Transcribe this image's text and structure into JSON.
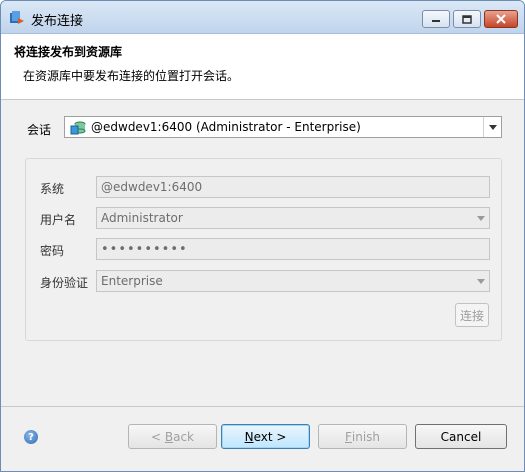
{
  "window": {
    "title": "发布连接"
  },
  "header": {
    "title": "将连接发布到资源库",
    "description": "在资源库中要发布连接的位置打开会话。"
  },
  "session": {
    "label": "会话",
    "value": "@edwdev1:6400 (Administrator - Enterprise)"
  },
  "fields": {
    "system": {
      "label": "系统",
      "value": "@edwdev1:6400"
    },
    "username": {
      "label": "用户名",
      "value": "Administrator"
    },
    "password": {
      "label": "密码",
      "value": "••••••••••"
    },
    "auth": {
      "label": "身份验证",
      "value": "Enterprise"
    }
  },
  "connect_label": "连接",
  "buttons": {
    "back_prefix": "< ",
    "back_key": "B",
    "back_rest": "ack",
    "next_key": "N",
    "next_rest": "ext >",
    "finish_key": "F",
    "finish_rest": "inish",
    "cancel": "Cancel"
  }
}
